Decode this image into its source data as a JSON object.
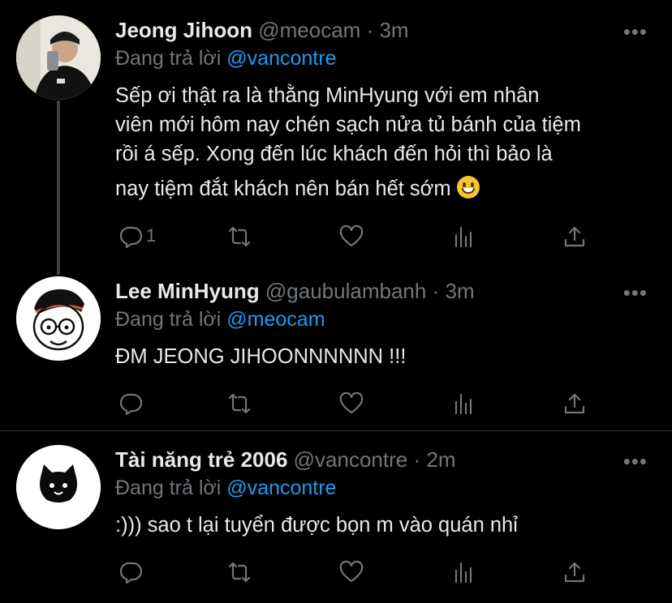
{
  "tweets": [
    {
      "name": "Jeong Jihoon",
      "handle": "@meocam",
      "separator": "·",
      "time": "3m",
      "reply_prefix": "Đang trả lời",
      "reply_to": "@vancontre",
      "text_lines": [
        "Sếp ơi thật ra là thằng MinHyung với em nhân",
        "viên mới hôm nay chén sạch nửa tủ bánh của tiệm",
        "rồi á sếp. Xong đến lúc khách đến hỏi thì bảo là",
        "nay tiệm đắt khách nên bán hết sớm"
      ],
      "emoji": "grinning-face",
      "reply_count": "1",
      "more": "•••"
    },
    {
      "name": "Lee MinHyung",
      "handle": "@gaubulambanh",
      "separator": "·",
      "time": "3m",
      "reply_prefix": "Đang trả lời",
      "reply_to": "@meocam",
      "text_lines": [
        "ĐM JEONG JIHOONNNNNN !!!"
      ],
      "reply_count": "",
      "more": "•••"
    },
    {
      "name": "Tài năng trẻ 2006",
      "handle": "@vancontre",
      "separator": "·",
      "time": "2m",
      "reply_prefix": "Đang trả lời",
      "reply_to": "@vancontre",
      "text_lines": [
        ":))) sao t lại tuyển được bọn m vào quán nhỉ"
      ],
      "reply_count": "",
      "more": "•••"
    }
  ],
  "icons": {
    "reply": "reply-icon",
    "retweet": "retweet-icon",
    "like": "like-icon",
    "analytics": "analytics-icon",
    "share": "share-icon"
  },
  "colors": {
    "background": "#000000",
    "accent": "#1d9bf0",
    "secondary_text": "#71767b",
    "primary_text": "#e7e9ea"
  }
}
